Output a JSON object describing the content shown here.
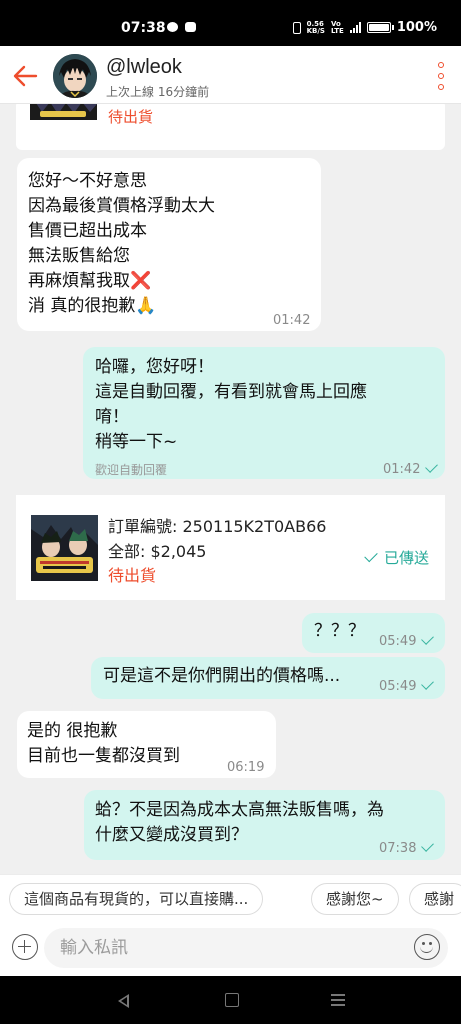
{
  "status_bar": {
    "time": "07:38",
    "net_speed": "0.56",
    "net_unit": "KB/S",
    "lte_a": "Vo",
    "lte_b": "LTE",
    "battery": "100%",
    "battery_level": 1.0
  },
  "header": {
    "back_icon": "arrow-left-icon",
    "username": "@lwleok",
    "last_seen": "上次上線 16分鐘前",
    "more_icon": "more-vertical-icon",
    "accent": "#ee4d2d"
  },
  "messages": {
    "top_card_status": "待出貨",
    "m1": {
      "text": "您好～不好意思\n因為最後賞價格浮動太大\n售價已超出成本\n無法販售給您\n再麻煩幫我取❌\n消 真的很抱歉🙏",
      "time": "01:42"
    },
    "m2": {
      "text": "哈囉，您好呀！\n這是自動回覆，有看到就會馬上回應\n唷！\n稍等一下~",
      "note": "歡迎自動回覆",
      "time": "01:42"
    },
    "order": {
      "number": "訂單編號: 250115K2T0AB66",
      "total": "全部: $2,045",
      "status": "待出貨",
      "sent": "已傳送"
    },
    "m3": {
      "text": "？？？",
      "time": "05:49"
    },
    "m4": {
      "text": "可是這不是你們開出的價格嗎...",
      "time": "05:49"
    },
    "m5": {
      "text": "是的 很抱歉\n目前也一隻都沒買到",
      "time": "06:19"
    },
    "m6": {
      "text": "蛤？不是因為成本太高無法販售嗎，為\n什麼又變成沒買到？",
      "time": "07:38"
    }
  },
  "quick_replies": [
    "這個商品有現貨的，可以直接購...",
    "感謝您~",
    "感謝"
  ],
  "input": {
    "placeholder": "輸入私訊",
    "bubble_out_color": "#d3f5ef"
  }
}
